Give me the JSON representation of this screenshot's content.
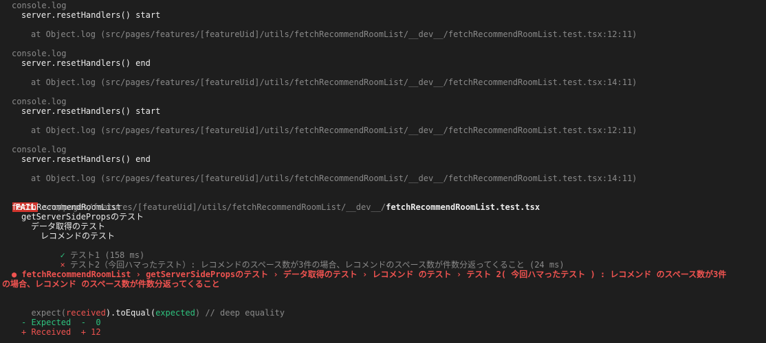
{
  "logs": [
    {
      "label": "console.log",
      "message": "server.resetHandlers() start",
      "location": "at Object.log (src/pages/features/[featureUid]/utils/fetchRecommendRoomList/__dev__/fetchRecommendRoomList.test.tsx:12:11)"
    },
    {
      "label": "console.log",
      "message": "server.resetHandlers() end",
      "location": "at Object.log (src/pages/features/[featureUid]/utils/fetchRecommendRoomList/__dev__/fetchRecommendRoomList.test.tsx:14:11)"
    },
    {
      "label": "console.log",
      "message": "server.resetHandlers() start",
      "location": "at Object.log (src/pages/features/[featureUid]/utils/fetchRecommendRoomList/__dev__/fetchRecommendRoomList.test.tsx:12:11)"
    },
    {
      "label": "console.log",
      "message": "server.resetHandlers() end",
      "location": "at Object.log (src/pages/features/[featureUid]/utils/fetchRecommendRoomList/__dev__/fetchRecommendRoomList.test.tsx:14:11)"
    }
  ],
  "result": {
    "badge": "FAIL",
    "path_dir": "src/pages/features/[featureUid]/utils/fetchRecommendRoomList/__dev__/",
    "path_file": "fetchRecommendRoomList.test.tsx"
  },
  "tree": {
    "suite": "fetchRecommendRoomList",
    "describe1": "getServerSidePropsのテスト",
    "describe2": "データ取得のテスト",
    "describe3": "レコメンドのテスト",
    "pass_mark": "✓",
    "pass_name": "テスト1 (158 ms)",
    "fail_mark": "×",
    "fail_name": "テスト2（今回ハマったテスト）: レコメンドのスペース数が3件の場合、レコメンドのスペース数が件数分返ってくること (24 ms)"
  },
  "failure": {
    "header_line1": "● fetchRecommendRoomList › getServerSidePropsのテスト › データ取得のテスト › レコメンド のテスト › テスト 2( 今回ハマったテスト ) : レコメンド のスペース数が3件",
    "header_line2": "の場合、レコメンド のスペース数が件数分返ってくること"
  },
  "assertion": {
    "expect": "expect(",
    "received": "received",
    "close_to_equal": ").toEqual(",
    "expected": "expected",
    "close_comment": ") // deep equality"
  },
  "diff": {
    "expected_line": "- Expected  -  0",
    "received_line": "+ Received  + 12"
  },
  "colors": {
    "background": "#1e1e1e",
    "fail_badge": "#d0342c",
    "error_red": "#ef5350",
    "success_green": "#2ec27e"
  }
}
